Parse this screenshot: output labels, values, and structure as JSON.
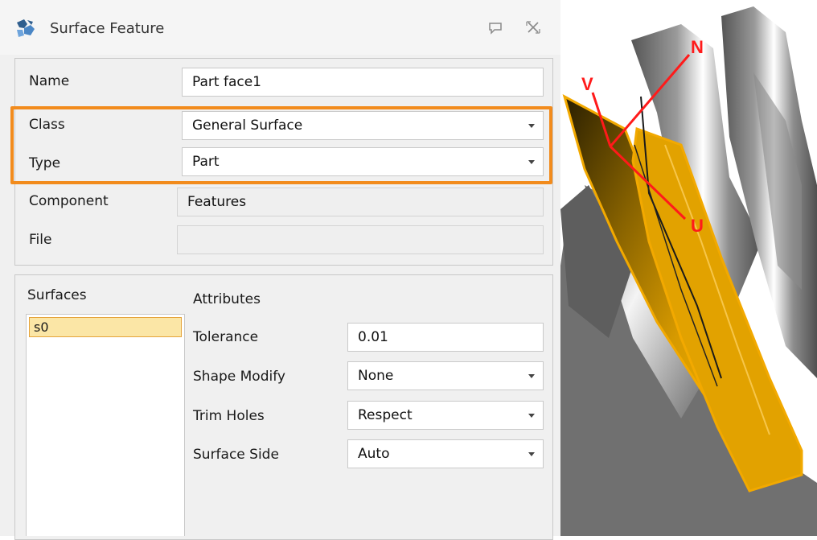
{
  "window": {
    "title": "Surface Feature",
    "controls": [
      "comment-icon",
      "close-icon"
    ]
  },
  "general": {
    "name_label": "Name",
    "name_value": "Part face1",
    "class_label": "Class",
    "class_value": "General Surface",
    "type_label": "Type",
    "type_value": "Part",
    "component_label": "Component",
    "component_value": "Features",
    "file_label": "File",
    "file_value": ""
  },
  "surfaces": {
    "label": "Surfaces",
    "items": [
      "s0"
    ]
  },
  "attributes": {
    "title": "Attributes",
    "tolerance_label": "Tolerance",
    "tolerance_value": "0.01",
    "shape_modify_label": "Shape Modify",
    "shape_modify_value": "None",
    "trim_holes_label": "Trim Holes",
    "trim_holes_value": "Respect",
    "surface_side_label": "Surface Side",
    "surface_side_value": "Auto"
  },
  "viewport": {
    "axis_labels": {
      "n": "N",
      "v": "V",
      "u": "U"
    },
    "axis_color": "#ff0000",
    "highlight_color": "#f2a900"
  },
  "colors": {
    "highlight_border": "#f28b1c",
    "selected_item_bg": "#fbe6a6"
  }
}
